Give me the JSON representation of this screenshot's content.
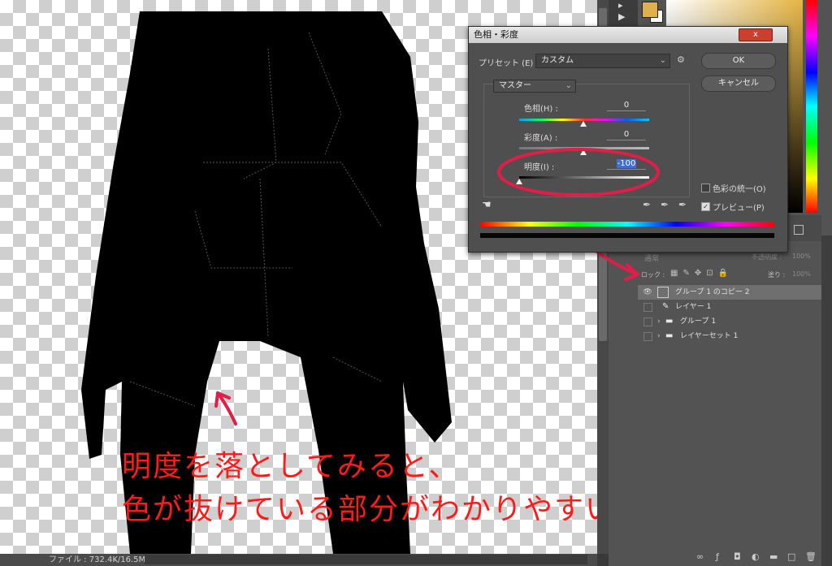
{
  "dialog": {
    "title": "色相・彩度",
    "close_label": "x",
    "preset_label": "プリセット (E) :",
    "preset_value": "カスタム",
    "ok_label": "OK",
    "cancel_label": "キャンセル",
    "channel_value": "マスター",
    "hue_label": "色相(H) :",
    "hue_value": "0",
    "saturation_label": "彩度(A) :",
    "saturation_value": "0",
    "lightness_label": "明度(I) :",
    "lightness_value": "-100",
    "colorize_label": "色彩の統一(O)",
    "preview_label": "プレビュー(P)",
    "preview_checked": true,
    "colorize_checked": false,
    "adjust": {
      "hue": 0,
      "saturation": 0,
      "lightness": -100
    }
  },
  "layers": {
    "blend_mode": "通常",
    "opacity_label": "不透明度 :",
    "opacity_value": "100%",
    "lock_label": "ロック :",
    "fill_label": "塗り :",
    "fill_value": "100%",
    "items": [
      {
        "name": "グループ 1 のコピー 2",
        "selected": true,
        "icon": "adjustment-icon"
      },
      {
        "name": "レイヤー 1",
        "selected": false,
        "icon": "brush-icon"
      },
      {
        "name": "グループ 1",
        "selected": false,
        "icon": "folder-icon"
      },
      {
        "name": "レイヤーセット 1",
        "selected": false,
        "icon": "folder-icon"
      }
    ]
  },
  "status": {
    "file_info": "ファイル : 732.4K/16.5M"
  },
  "annotation": {
    "line1": "明度を落としてみると、",
    "line2": "色が抜けている部分がわかりやすい",
    "color": "#ff1a1a"
  },
  "colors": {
    "foreground": "#e0b04c",
    "background": "#ffffff",
    "accent_red": "#ff1a1a"
  }
}
